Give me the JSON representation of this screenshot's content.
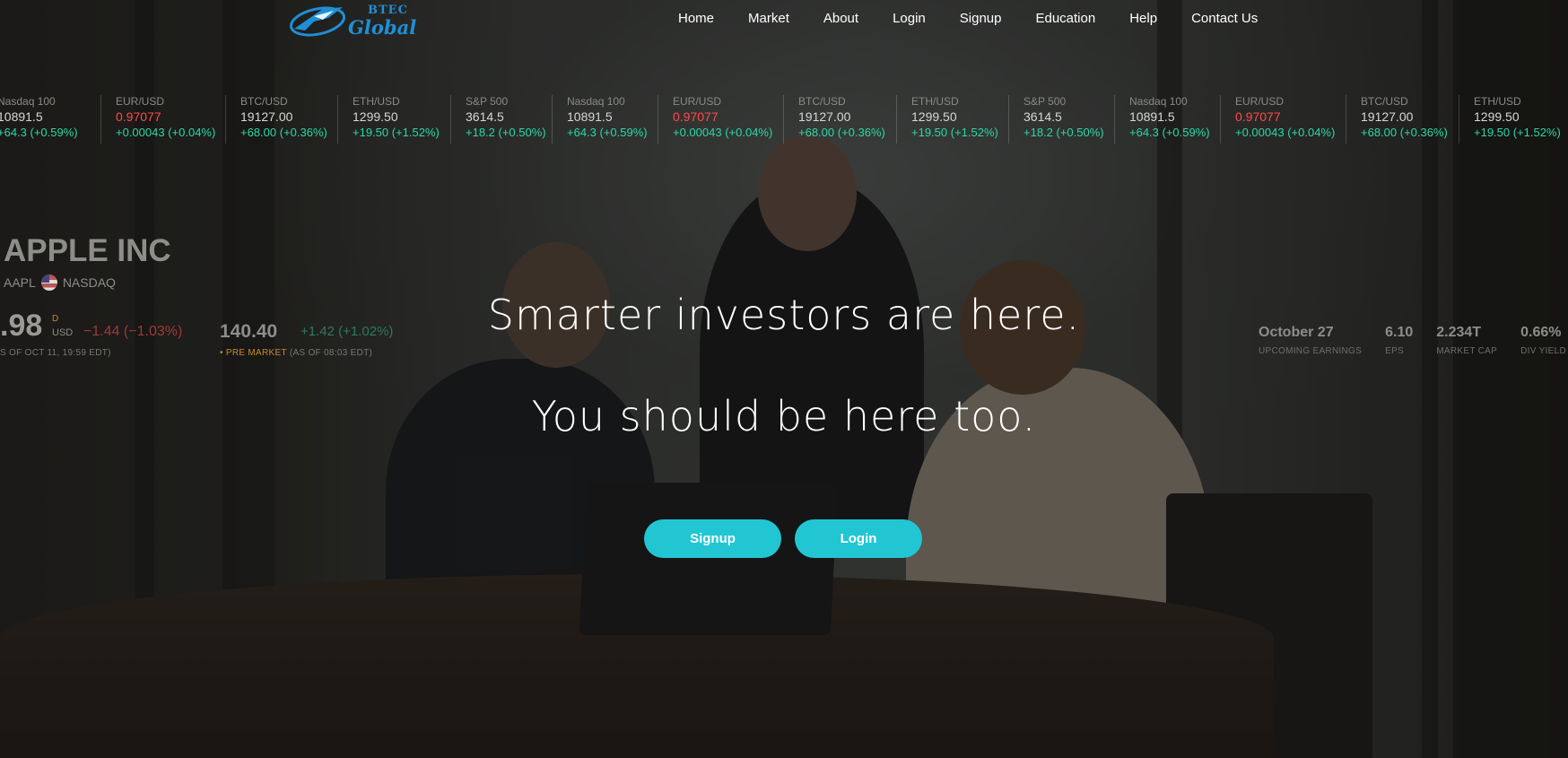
{
  "nav": {
    "logo_top": "BTEC",
    "logo_main": "Global",
    "items": [
      "Home",
      "Market",
      "About",
      "Login",
      "Signup",
      "Education",
      "Help",
      "Contact Us"
    ]
  },
  "ticker": [
    {
      "symbol": "Nasdaq 100",
      "price": "10891.5",
      "change": "+64.3 (+0.59%)",
      "direction": "up"
    },
    {
      "symbol": "EUR/USD",
      "price": "0.97077",
      "change": "+0.00043 (+0.04%)",
      "direction": "down"
    },
    {
      "symbol": "BTC/USD",
      "price": "19127.00",
      "change": "+68.00 (+0.36%)",
      "direction": "up"
    },
    {
      "symbol": "ETH/USD",
      "price": "1299.50",
      "change": "+19.50 (+1.52%)",
      "direction": "up"
    },
    {
      "symbol": "S&P 500",
      "price": "3614.5",
      "change": "+18.2 (+0.50%)",
      "direction": "up"
    },
    {
      "symbol": "Nasdaq 100",
      "price": "10891.5",
      "change": "+64.3 (+0.59%)",
      "direction": "up"
    },
    {
      "symbol": "EUR/USD",
      "price": "0.97077",
      "change": "+0.00043 (+0.04%)",
      "direction": "down"
    },
    {
      "symbol": "BTC/USD",
      "price": "19127.00",
      "change": "+68.00 (+0.36%)",
      "direction": "up"
    },
    {
      "symbol": "ETH/USD",
      "price": "1299.50",
      "change": "+19.50 (+1.52%)",
      "direction": "up"
    },
    {
      "symbol": "S&P 500",
      "price": "3614.5",
      "change": "+18.2 (+0.50%)",
      "direction": "up"
    },
    {
      "symbol": "Nasdaq 100",
      "price": "10891.5",
      "change": "+64.3 (+0.59%)",
      "direction": "up"
    },
    {
      "symbol": "EUR/USD",
      "price": "0.97077",
      "change": "+0.00043 (+0.04%)",
      "direction": "down"
    },
    {
      "symbol": "BTC/USD",
      "price": "19127.00",
      "change": "+68.00 (+0.36%)",
      "direction": "up"
    },
    {
      "symbol": "ETH/USD",
      "price": "1299.50",
      "change": "+19.50 (+1.52%)",
      "direction": "up"
    }
  ],
  "stock": {
    "name": "APPLE INC",
    "ticker": "AAPL",
    "exchange": "NASDAQ",
    "price": ".98",
    "currency_flag": "D",
    "currency": "USD",
    "change": "−1.44  (−1.03%)",
    "as_of": "S OF OCT 11, 19:59 EDT)",
    "pre_price": "140.40",
    "pre_change": "+1.42  (+1.02%)",
    "pre_label": "PRE MARKET",
    "pre_as_of": "(AS OF 08:03 EDT)"
  },
  "stats": [
    {
      "value": "October 27",
      "label": "UPCOMING EARNINGS"
    },
    {
      "value": "6.10",
      "label": "EPS"
    },
    {
      "value": "2.234T",
      "label": "MARKET CAP"
    },
    {
      "value": "0.66%",
      "label": "DIV YIELD"
    }
  ],
  "hero": {
    "line1": "Smarter investors are here.",
    "line2": "You should be here too.",
    "signup_label": "Signup",
    "login_label": "Login"
  },
  "colors": {
    "accent": "#22c6d3",
    "positive": "#2bd8a6",
    "negative": "#ff4a4a",
    "logo": "#1f8fd6"
  }
}
